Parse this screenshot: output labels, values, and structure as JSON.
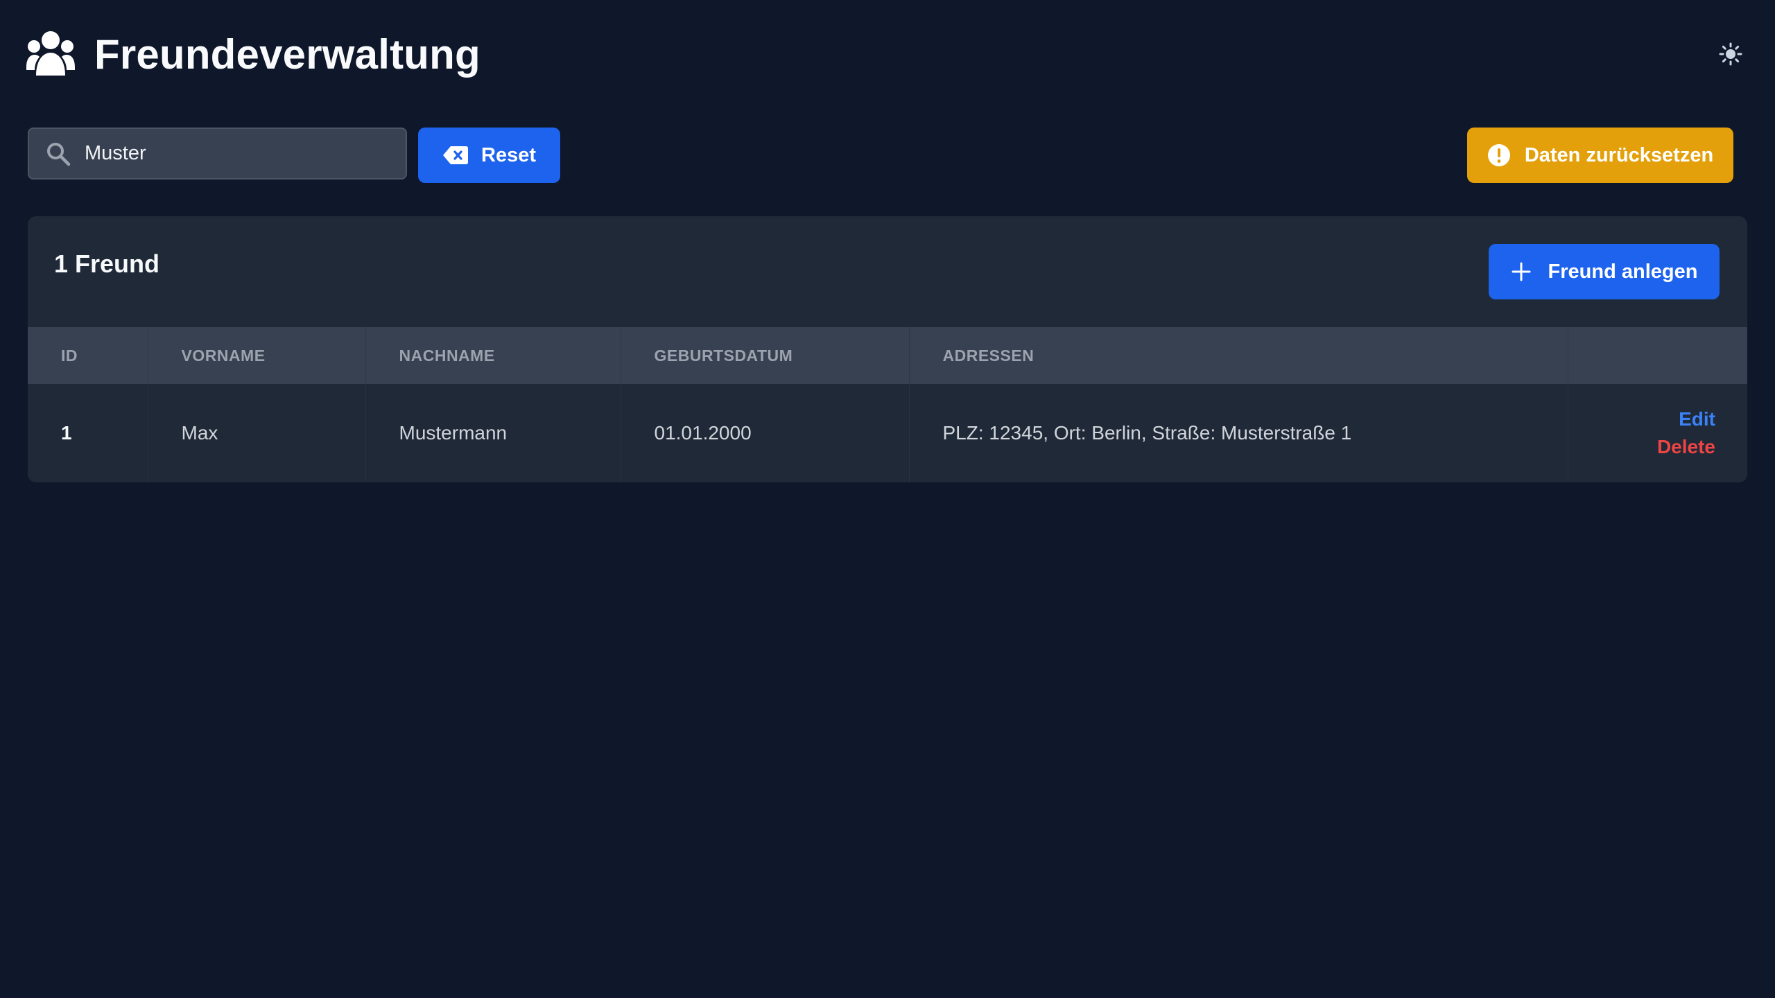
{
  "app": {
    "title": "Freundeverwaltung"
  },
  "icons": {
    "logo": "users-icon",
    "theme": "sun-icon",
    "search": "search-icon",
    "reset": "backspace-icon",
    "warning": "exclamation-circle-icon",
    "add": "plus-icon"
  },
  "toolbar": {
    "search_value": "Muster",
    "reset_label": "Reset",
    "data_reset_label": "Daten zurücksetzen"
  },
  "panel": {
    "count_label": "1 Freund",
    "add_label": "Freund anlegen"
  },
  "table": {
    "headers": [
      "ID",
      "VORNAME",
      "NACHNAME",
      "GEBURTSDATUM",
      "ADRESSEN",
      ""
    ],
    "rows": [
      {
        "id": "1",
        "vorname": "Max",
        "nachname": "Mustermann",
        "geburtsdatum": "01.01.2000",
        "adressen": "PLZ: 12345, Ort: Berlin, Straße: Musterstraße 1",
        "edit_label": "Edit",
        "delete_label": "Delete"
      }
    ]
  },
  "colors": {
    "background": "#0f172a",
    "panel": "#1f2937",
    "primary": "#1d63ed",
    "warning": "#e4a00a",
    "edit": "#3b82f6",
    "delete": "#ef4444"
  }
}
